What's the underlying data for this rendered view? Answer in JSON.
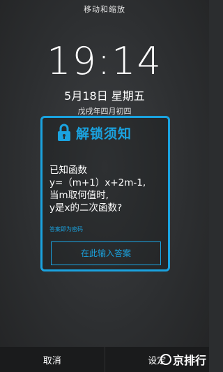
{
  "header": {
    "title": "移动和缩放"
  },
  "lockscreen": {
    "time": "19:14",
    "date": "5月18日 星期五",
    "lunar_date": "戊戌年四月初四"
  },
  "dialog": {
    "title": "解锁须知",
    "question_lines": [
      "已知函数",
      "y=（m+1）x+2m-1,",
      "当m取何值时,",
      "y是x的二次函数?"
    ],
    "hint": "答案即为密码",
    "answer_placeholder": "在此输入答案",
    "accent_color": "#1aa3e0"
  },
  "bottom_bar": {
    "cancel_label": "取消",
    "confirm_label": "设定"
  },
  "watermark": {
    "text": "京排行"
  }
}
